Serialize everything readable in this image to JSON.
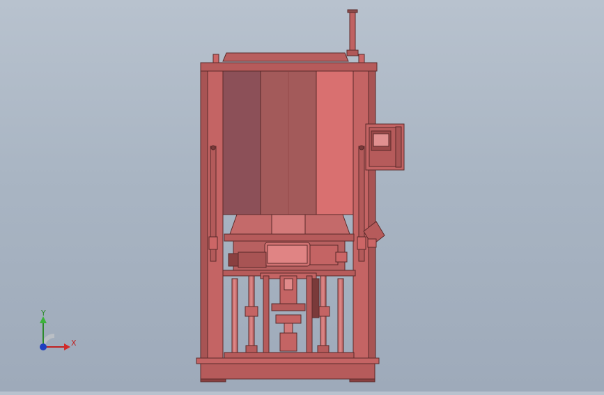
{
  "triad": {
    "x_label": "X",
    "y_label": "Y"
  },
  "colors": {
    "background": "#a9b5c3",
    "body": "#b65b5b",
    "panel_left": "#8c5058",
    "panel_mid": "#a35a5a",
    "panel_right": "#d97070",
    "outline": "#5a2a2a",
    "x_axis": "#c02020",
    "y_axis": "#2b8a2b",
    "z_axis": "#1f3fc0"
  }
}
